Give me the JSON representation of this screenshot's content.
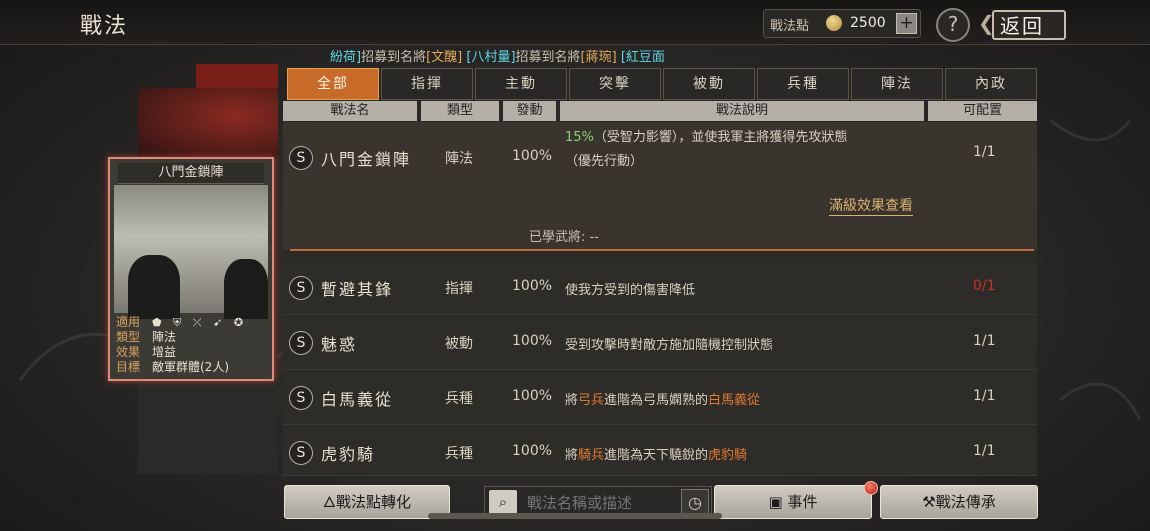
{
  "header": {
    "title": "戰法",
    "points_label": "戰法點",
    "points_value": "2500",
    "plus": "+",
    "help": "?",
    "back_label": "返回"
  },
  "ticker": [
    {
      "text": "紛荷]",
      "color": "cyan"
    },
    {
      "text": "招募到名將",
      "color": "white"
    },
    {
      "text": "[文醜]",
      "color": "yellow"
    },
    {
      "text": "  [八村量]",
      "color": "cyan"
    },
    {
      "text": "招募到名將",
      "color": "white"
    },
    {
      "text": "[蔣琬]",
      "color": "yellow"
    },
    {
      "text": "  [紅豆面",
      "color": "cyan"
    }
  ],
  "card": {
    "title": "八門金鎖陣",
    "rows": [
      {
        "key": "適用",
        "value": "⬟ ⛨ ⤫ ➹ ✪"
      },
      {
        "key": "類型",
        "value": "陣法"
      },
      {
        "key": "效果",
        "value": "增益"
      },
      {
        "key": "目標",
        "value": "敵軍群體(2人)"
      }
    ]
  },
  "tabs": [
    "全部",
    "指揮",
    "主動",
    "突擊",
    "被動",
    "兵種",
    "陣法",
    "內政"
  ],
  "columns": [
    "戰法名",
    "類型",
    "發動",
    "戰法說明",
    "可配置"
  ],
  "expanded": {
    "s": "S",
    "name": "八門金鎖陣",
    "type": "陣法",
    "pct": "100%",
    "desc_line1_green": "15%",
    "desc_line1": "（受智力影響），並使我軍主將獲得先攻狀態",
    "desc_line2": "（優先行動）",
    "cfg": "1/1",
    "link": "滿級效果查看",
    "learned": "已學武將:  --"
  },
  "rows": [
    {
      "s": "S",
      "name": "暫避其鋒",
      "type": "指揮",
      "pct": "100%",
      "desc_pre": "使我方受到的傷害降低",
      "desc_hl1": "",
      "desc_mid": "",
      "desc_hl2": "",
      "cfg": "0/1",
      "cfg_red": true
    },
    {
      "s": "S",
      "name": "魅惑",
      "type": "被動",
      "pct": "100%",
      "desc_pre": "受到攻擊時對敵方施加隨機控制狀態",
      "desc_hl1": "",
      "desc_mid": "",
      "desc_hl2": "",
      "cfg": "1/1",
      "cfg_red": false
    },
    {
      "s": "S",
      "name": "白馬義從",
      "type": "兵種",
      "pct": "100%",
      "desc_pre": "將",
      "desc_hl1": "弓兵",
      "desc_mid": "進階為弓馬嫻熟的",
      "desc_hl2": "白馬義從",
      "cfg": "1/1",
      "cfg_red": false
    },
    {
      "s": "S",
      "name": "虎豹騎",
      "type": "兵種",
      "pct": "100%",
      "desc_pre": "將",
      "desc_hl1": "騎兵",
      "desc_mid": "進階為天下驍銳的",
      "desc_hl2": "虎豹騎",
      "cfg": "1/1",
      "cfg_red": false
    }
  ],
  "bottom": {
    "convert_label": "戰法點轉化",
    "search_placeholder": "戰法名稱或描述",
    "event_label": "事件",
    "inherit_label": "戰法傳承"
  }
}
